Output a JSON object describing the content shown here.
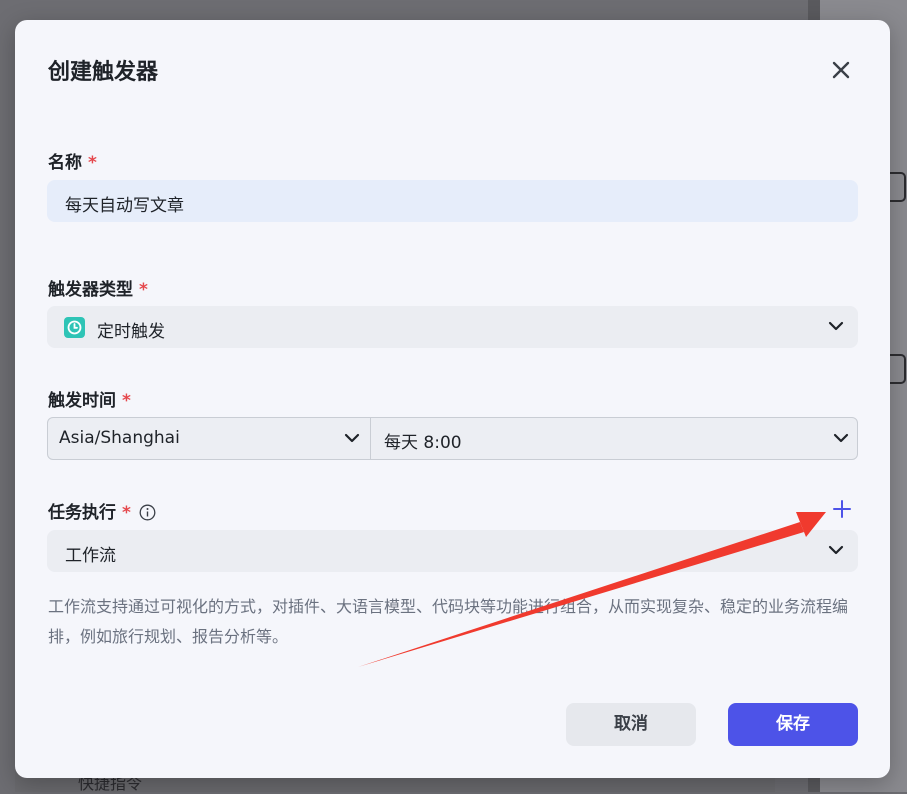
{
  "background": {
    "hidden_text": "快捷指令"
  },
  "modal": {
    "title": "创建触发器",
    "required_mark": "*"
  },
  "name_field": {
    "label": "名称",
    "value": "每天自动写文章"
  },
  "trigger_type": {
    "label": "触发器类型",
    "value": "定时触发",
    "icon": "clock-icon"
  },
  "trigger_time": {
    "label": "触发时间",
    "timezone": "Asia/Shanghai",
    "schedule": "每天 8:00"
  },
  "task": {
    "label": "任务执行",
    "value": "工作流",
    "description": "工作流支持通过可视化的方式，对插件、大语言模型、代码块等功能进行组合，从而实现复杂、稳定的业务流程编排，例如旅行规划、报告分析等。"
  },
  "buttons": {
    "cancel": "取消",
    "save": "保存"
  },
  "colors": {
    "primary": "#4d53e8",
    "required": "#e5484d",
    "annotation_arrow": "#f03a2e",
    "timer_badge": "#2ec4b6"
  }
}
